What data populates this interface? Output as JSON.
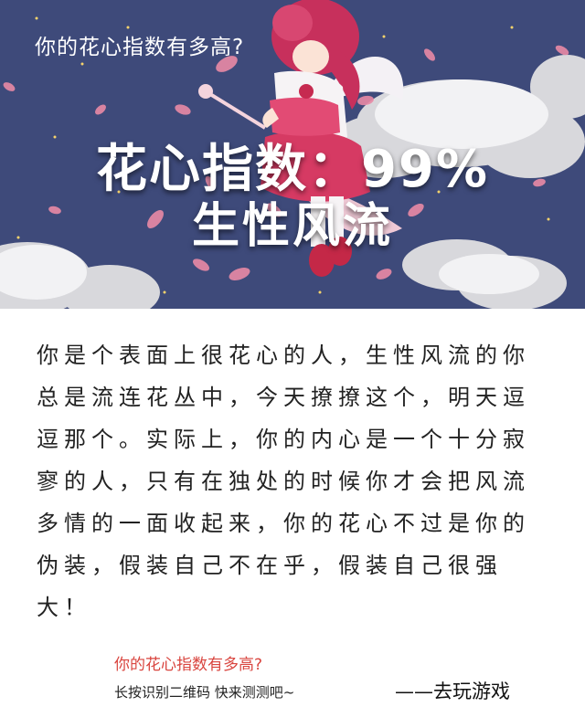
{
  "banner": {
    "quiz_title": "你的花心指数有多高?",
    "headline": "花心指数：99%",
    "subheadline": "生性风流"
  },
  "result": {
    "description": "你是个表面上很花心的人，生性风流的你总是流连花丛中，今天撩撩这个，明天逗逗那个。实际上，你的内心是一个十分寂寥的人，只有在独处的时候你才会把风流多情的一面收起来，你的花心不过是你的伪装，假装自己不在乎，假装自己很强大！"
  },
  "footer": {
    "quiz_question": "你的花心指数有多高?",
    "qr_hint": "长按识别二维码  快来测测吧~",
    "play_link": "——去玩游戏"
  },
  "colors": {
    "banner_bg": "#3c4a78",
    "petal_pink": "#e98aa6",
    "question_red": "#d9453f"
  }
}
